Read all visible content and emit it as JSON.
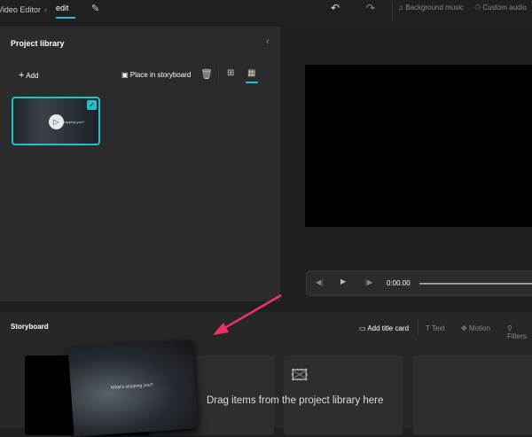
{
  "header": {
    "app": "Video Editor",
    "breadcrumb_sep": "›",
    "project": "edit",
    "undo": "undo",
    "redo": "redo",
    "background_music": "Background music",
    "custom_audio": "Custom audio"
  },
  "library": {
    "title": "Project library",
    "add": "Add",
    "place": "Place in storyboard",
    "clip_caption": "What's stopping you?"
  },
  "player": {
    "time": "0:00.00",
    "progress": 0
  },
  "storyboard": {
    "title": "Storyboard",
    "add_title_card": "Add title card",
    "text": "Text",
    "motion": "Motion",
    "filters": "Filters",
    "drop_hint": "Drag items from the project library here",
    "drag_caption": "What's stopping you?"
  },
  "colors": {
    "accent": "#1ec0d0",
    "arrow": "#f0306a"
  }
}
